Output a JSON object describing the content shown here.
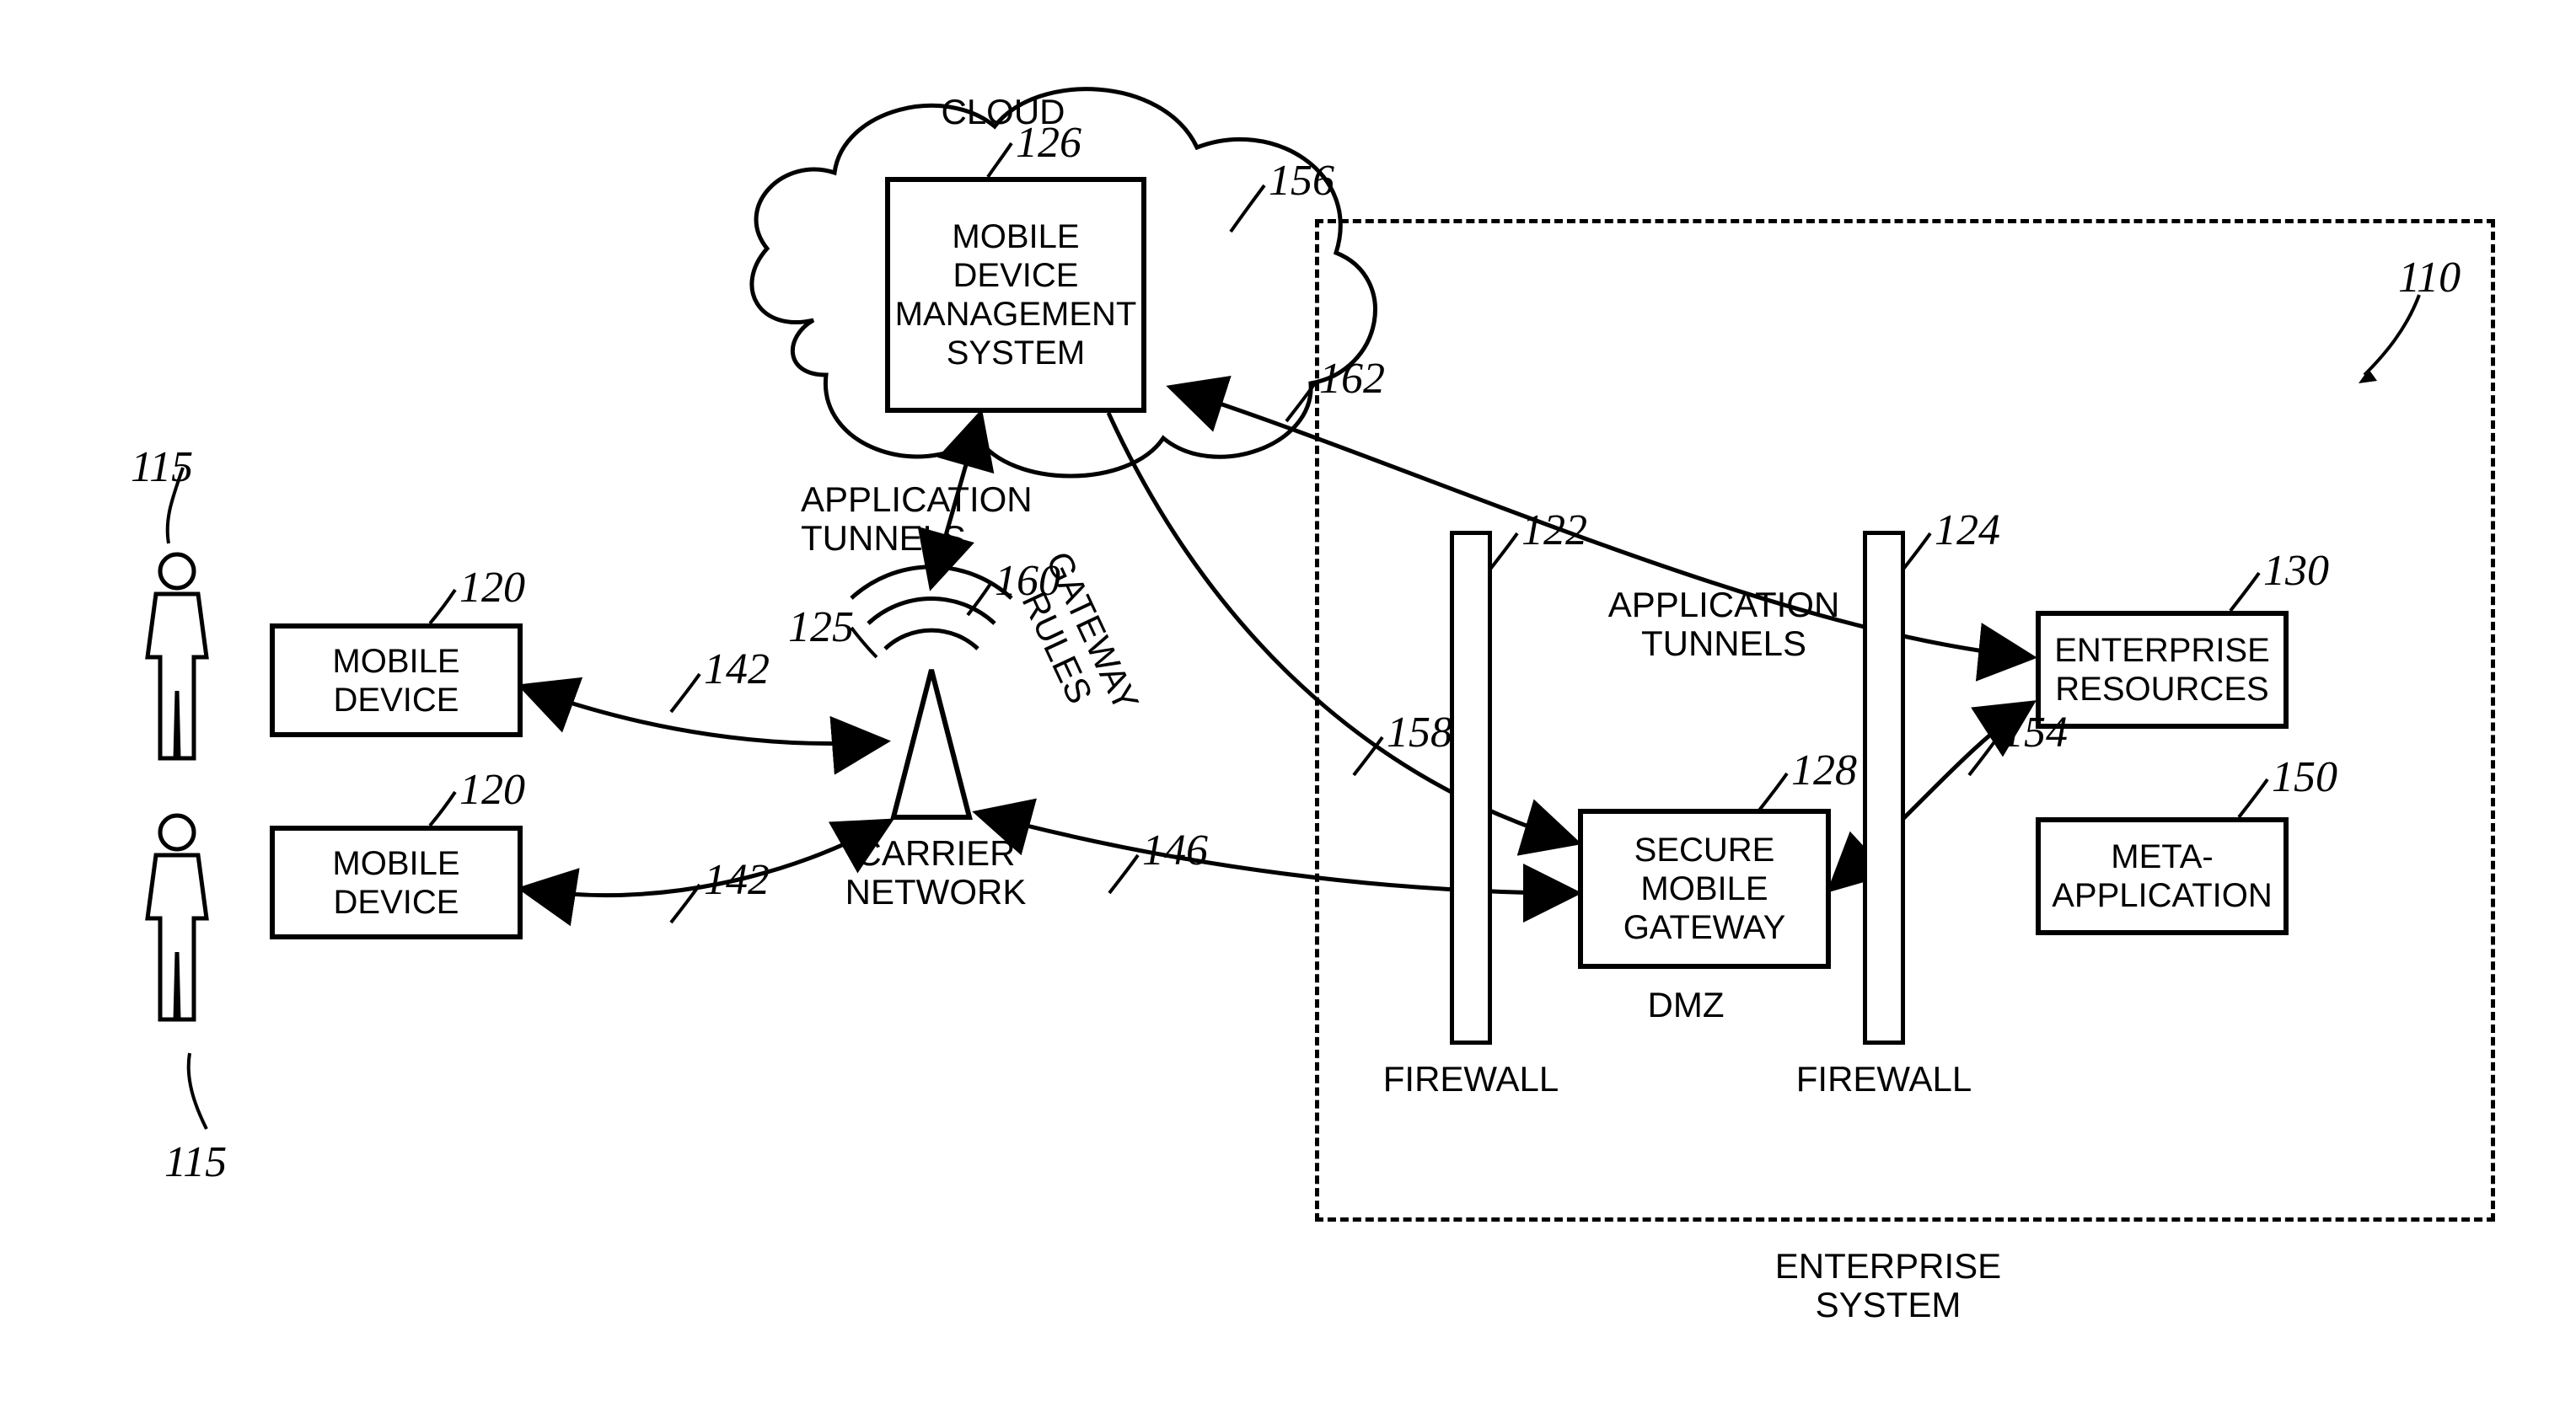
{
  "cloud": {
    "title": "CLOUD",
    "ref_156": "156"
  },
  "mdm": {
    "label": "MOBILE\nDEVICE\nMANAGEMENT\nSYSTEM",
    "ref": "126"
  },
  "mobile_device_1": {
    "label": "MOBILE\nDEVICE",
    "ref": "120"
  },
  "mobile_device_2": {
    "label": "MOBILE\nDEVICE",
    "ref": "120"
  },
  "carrier": {
    "label": "CARRIER\nNETWORK",
    "ref": "125"
  },
  "app_tunnels_up": {
    "label": "APPLICATION\nTUNNELS",
    "ref": "160"
  },
  "app_tunnels_right": {
    "label": "APPLICATION\nTUNNELS",
    "ref": "162"
  },
  "gateway_rules": {
    "label": "GATEWAY\nRULES",
    "ref": "158"
  },
  "enterprise_resources": {
    "label": "ENTERPRISE\nRESOURCES",
    "ref": "130"
  },
  "meta_app": {
    "label": "META-\nAPPLICATION",
    "ref": "150"
  },
  "secure_gateway": {
    "label": "SECURE\nMOBILE\nGATEWAY",
    "ref": "128"
  },
  "firewall_left": {
    "label": "FIREWALL",
    "ref": "122"
  },
  "firewall_right": {
    "label": "FIREWALL",
    "ref": "124"
  },
  "dmz": {
    "label": "DMZ"
  },
  "enterprise_system": {
    "label": "ENTERPRISE\nSYSTEM",
    "ref": "110"
  },
  "person_1": {
    "ref": "115"
  },
  "person_2": {
    "ref": "115"
  },
  "arrow_142_1": {
    "ref": "142"
  },
  "arrow_142_2": {
    "ref": "142"
  },
  "arrow_146": {
    "ref": "146"
  },
  "arrow_154": {
    "ref": "154"
  }
}
